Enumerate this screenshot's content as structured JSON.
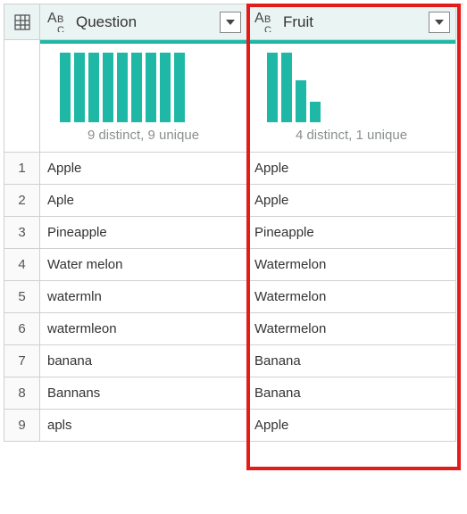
{
  "header": {
    "col1_label": "Question",
    "col2_label": "Fruit"
  },
  "profile": {
    "col1_summary": "9 distinct, 9 unique",
    "col2_summary": "4 distinct, 1 unique",
    "col1_bars": [
      100,
      100,
      100,
      100,
      100,
      100,
      100,
      100,
      100
    ],
    "col2_bars": [
      100,
      100,
      60,
      30
    ]
  },
  "rows": [
    {
      "n": "1",
      "question": "Apple",
      "fruit": "Apple"
    },
    {
      "n": "2",
      "question": "Aple",
      "fruit": "Apple"
    },
    {
      "n": "3",
      "question": "Pineapple",
      "fruit": "Pineapple"
    },
    {
      "n": "4",
      "question": "Water melon",
      "fruit": "Watermelon"
    },
    {
      "n": "5",
      "question": "watermln",
      "fruit": "Watermelon"
    },
    {
      "n": "6",
      "question": "watermleon",
      "fruit": "Watermelon"
    },
    {
      "n": "7",
      "question": "banana",
      "fruit": "Banana"
    },
    {
      "n": "8",
      "question": "Bannans",
      "fruit": "Banana"
    },
    {
      "n": "9",
      "question": "apls",
      "fruit": "Apple"
    }
  ],
  "chart_data": [
    {
      "type": "bar",
      "title": "Question column value distribution",
      "categories": [
        "Apple",
        "Aple",
        "Pineapple",
        "Water melon",
        "watermln",
        "watermleon",
        "banana",
        "Bannans",
        "apls"
      ],
      "values": [
        1,
        1,
        1,
        1,
        1,
        1,
        1,
        1,
        1
      ],
      "summary": "9 distinct, 9 unique"
    },
    {
      "type": "bar",
      "title": "Fruit column value distribution",
      "categories": [
        "Apple",
        "Watermelon",
        "Banana",
        "Pineapple"
      ],
      "values": [
        3,
        3,
        2,
        1
      ],
      "summary": "4 distinct, 1 unique"
    }
  ]
}
